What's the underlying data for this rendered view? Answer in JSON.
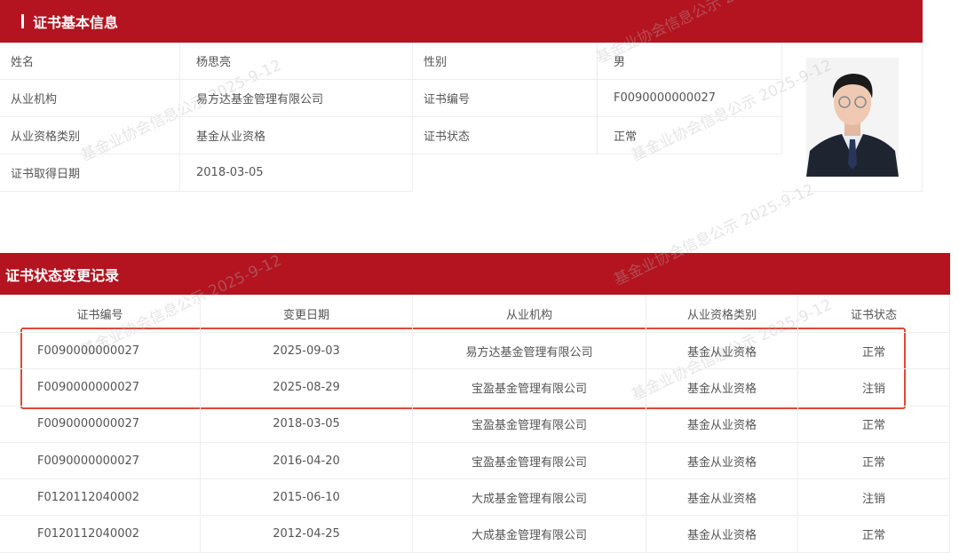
{
  "basic_info": {
    "title": "证书基本信息",
    "rows": [
      {
        "label1": "姓名",
        "value1": "杨思亮",
        "label2": "性别",
        "value2": "男"
      },
      {
        "label1": "从业机构",
        "value1": "易方达基金管理有限公司",
        "label2": "证书编号",
        "value2": "F0090000000027"
      },
      {
        "label1": "从业资格类别",
        "value1": "基金从业资格",
        "label2": "证书状态",
        "value2": "正常"
      },
      {
        "label1": "证书取得日期",
        "value1": "2018-03-05"
      }
    ]
  },
  "change_records": {
    "title": "证书状态变更记录",
    "headers": [
      "证书编号",
      "变更日期",
      "从业机构",
      "从业资格类别",
      "证书状态"
    ],
    "rows": [
      [
        "F0090000000027",
        "2025-09-03",
        "易方达基金管理有限公司",
        "基金从业资格",
        "正常"
      ],
      [
        "F0090000000027",
        "2025-08-29",
        "宝盈基金管理有限公司",
        "基金从业资格",
        "注销"
      ],
      [
        "F0090000000027",
        "2018-03-05",
        "宝盈基金管理有限公司",
        "基金从业资格",
        "正常"
      ],
      [
        "F0090000000027",
        "2016-04-20",
        "宝盈基金管理有限公司",
        "基金从业资格",
        "正常"
      ],
      [
        "F0120112040002",
        "2015-06-10",
        "大成基金管理有限公司",
        "基金从业资格",
        "注销"
      ],
      [
        "F0120112040002",
        "2012-04-25",
        "大成基金管理有限公司",
        "基金从业资格",
        "正常"
      ]
    ]
  },
  "watermark": "基金业协会信息公示 2025-9-12"
}
